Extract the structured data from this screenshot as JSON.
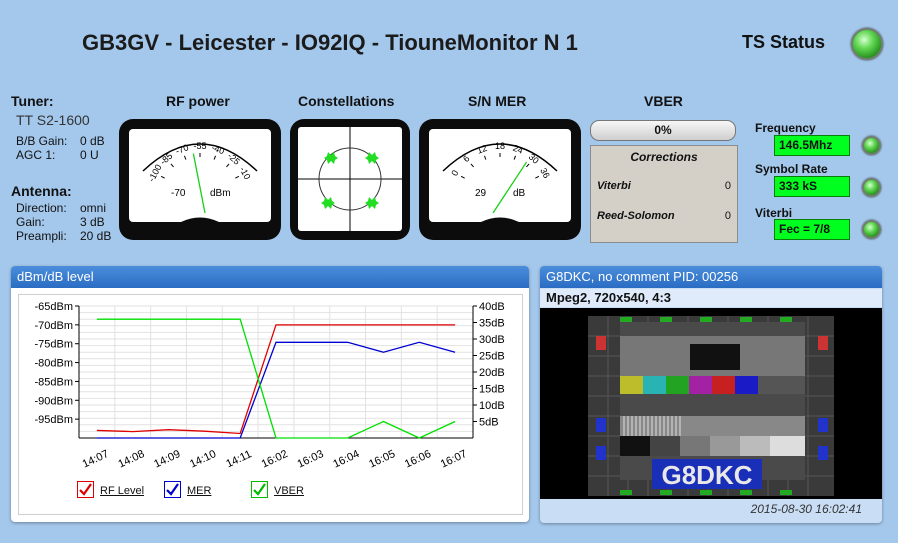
{
  "header": {
    "title": "GB3GV - Leicester - IO92IQ - TiouneMonitor N 1",
    "ts_status_label": "TS Status"
  },
  "tuner": {
    "heading": "Tuner:",
    "model": "TT S2-1600",
    "rows": [
      {
        "label": "B/B Gain:",
        "value": "0 dB"
      },
      {
        "label": "AGC 1:",
        "value": "0 U"
      }
    ]
  },
  "antenna": {
    "heading": "Antenna:",
    "rows": [
      {
        "label": "Direction:",
        "value": "omni"
      },
      {
        "label": "Gain:",
        "value": "3 dB"
      },
      {
        "label": "Preampli:",
        "value": "20 dB"
      }
    ]
  },
  "rf_power": {
    "heading": "RF power",
    "ticks": [
      "-100",
      "-85",
      "-70",
      "-55",
      "-40",
      "-25",
      "-10"
    ],
    "value": "-70",
    "unit": "dBm",
    "needle_fraction": 0.43
  },
  "constellations": {
    "heading": "Constellations"
  },
  "sn_mer": {
    "heading": "S/N MER",
    "ticks": [
      "0",
      "6",
      "12",
      "18",
      "24",
      "30",
      "36"
    ],
    "value": "29",
    "unit": "dB",
    "needle_fraction": 0.8
  },
  "vber": {
    "heading": "VBER",
    "value": "0%",
    "corrections": {
      "heading": "Corrections",
      "rows": [
        {
          "label": "Viterbi",
          "value": "0"
        },
        {
          "label": "Reed-Solomon",
          "value": "0"
        }
      ]
    }
  },
  "status": [
    {
      "label": "Frequency",
      "value": "146.5Mhz"
    },
    {
      "label": "Symbol Rate",
      "value": "333 kS"
    },
    {
      "label": "Viterbi",
      "value": "Fec = 7/8"
    }
  ],
  "level_panel": {
    "header": "dBm/dB level"
  },
  "chart_data": {
    "type": "line",
    "x": [
      "14:07",
      "14:08",
      "14:09",
      "14:10",
      "14:11",
      "16:02",
      "16:03",
      "16:04",
      "16:05",
      "16:06",
      "16:07"
    ],
    "y_left_ticks": [
      "-65dBm",
      "-70dBm",
      "-75dBm",
      "-80dBm",
      "-85dBm",
      "-90dBm",
      "-95dBm"
    ],
    "y_right_ticks": [
      "40dB",
      "35dB",
      "30dB",
      "25dB",
      "20dB",
      "15dB",
      "10dB",
      "5dB"
    ],
    "y_left_range": [
      -100,
      -65
    ],
    "y_right_range": [
      0,
      40
    ],
    "series": [
      {
        "name": "RF Level",
        "axis": "left",
        "color": "#e00000",
        "values": [
          -98,
          -98.3,
          -97.8,
          -98.2,
          -98.8,
          -70,
          -70,
          -70,
          -70,
          -70,
          -70
        ]
      },
      {
        "name": "MER",
        "axis": "right",
        "color": "#0000d0",
        "values": [
          0,
          0,
          0,
          0,
          0,
          29,
          29,
          29,
          26,
          29,
          26
        ]
      },
      {
        "name": "VBER",
        "axis": "right",
        "color": "#00e000",
        "values": [
          36,
          36,
          36,
          36,
          36,
          0,
          0,
          0,
          5,
          0,
          5
        ]
      }
    ],
    "grid": true
  },
  "video_panel": {
    "header": "G8DKC, no comment PID: 00256",
    "format": "Mpeg2, 720x540, 4:3",
    "overlay_text": "G8DKC",
    "timestamp": "2015-08-30 16:02:41"
  }
}
